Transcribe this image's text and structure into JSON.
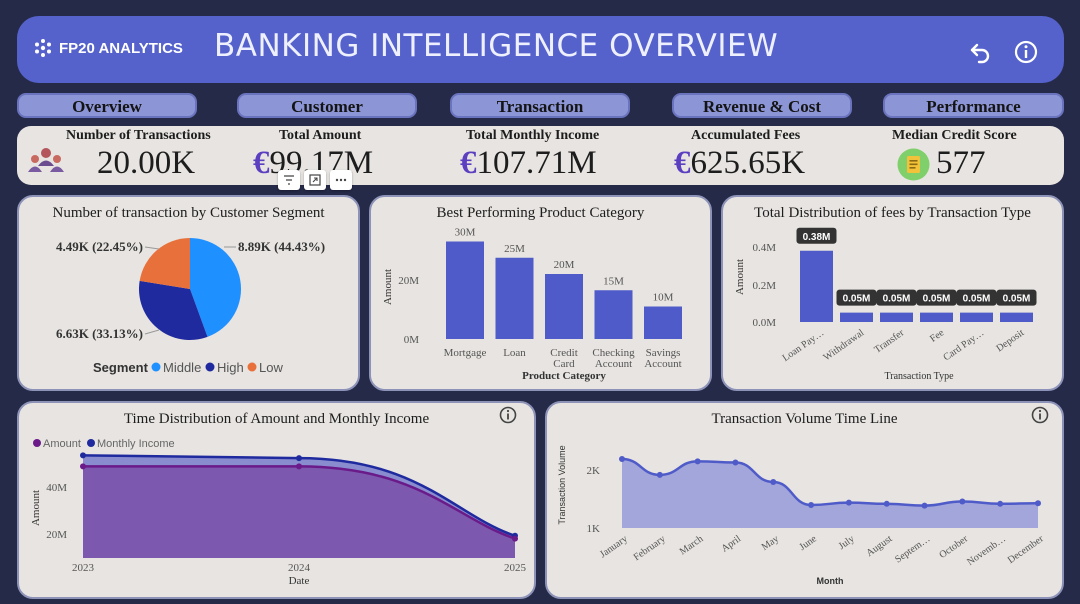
{
  "header": {
    "brand": "FP20 ANALYTICS",
    "title": "BANKING INTELLIGENCE OVERVIEW"
  },
  "tabs": [
    "Overview",
    "Customer",
    "Transaction",
    "Revenue & Cost",
    "Performance"
  ],
  "kpis": [
    {
      "label": "Number of Transactions",
      "value": "20.00K",
      "icon": "people-icon"
    },
    {
      "label": "Total Amount",
      "value": "99.17M",
      "currency": "€"
    },
    {
      "label": "Total Monthly Income",
      "value": "107.71M",
      "currency": "€"
    },
    {
      "label": "Accumulated Fees",
      "value": "625.65K",
      "currency": "€"
    },
    {
      "label": "Median Credit Score",
      "value": "577",
      "icon": "score-card-icon"
    }
  ],
  "colors": {
    "background": "#252a48",
    "header": "#5562cc",
    "bar": "#4f5bc8",
    "middle": "#1e90ff",
    "high": "#1f2a9e",
    "low": "#e8703a",
    "amount": "#6b1a8a",
    "income": "#1f2a9e"
  },
  "chart_data": [
    {
      "type": "pie",
      "title": "Number of transaction by Customer Segment",
      "legend_title": "Segment",
      "categories": [
        "Middle",
        "High",
        "Low"
      ],
      "values": [
        8.89,
        6.63,
        4.49
      ],
      "data_labels": [
        "8.89K (44.43%)",
        "6.63K (33.13%)",
        "4.49K (22.45%)"
      ],
      "legend_position": "bottom"
    },
    {
      "type": "bar",
      "title": "Best Performing Product Category",
      "xlabel": "Product Category",
      "ylabel": "Amount",
      "categories": [
        "Mortgage",
        "Loan",
        "Credit Card",
        "Checking Account",
        "Savings Account"
      ],
      "values": [
        30,
        25,
        20,
        15,
        10
      ],
      "data_labels": [
        "30M",
        "25M",
        "20M",
        "15M",
        "10M"
      ],
      "yticks": [
        "0M",
        "20M"
      ],
      "ylim": [
        0,
        32
      ]
    },
    {
      "type": "bar",
      "title": "Total Distribution of fees by Transaction Type",
      "xlabel": "Transaction Type",
      "ylabel": "Amount",
      "categories": [
        "Loan Pay…",
        "Withdrawal",
        "Transfer",
        "Fee",
        "Card Pay…",
        "Deposit"
      ],
      "values": [
        0.38,
        0.05,
        0.05,
        0.05,
        0.05,
        0.05
      ],
      "data_labels": [
        "0.38M",
        "0.05M",
        "0.05M",
        "0.05M",
        "0.05M",
        "0.05M"
      ],
      "yticks": [
        "0.0M",
        "0.2M",
        "0.4M"
      ],
      "ylim": [
        0,
        0.42
      ]
    },
    {
      "type": "area",
      "title": "Time Distribution of Amount and Monthly Income",
      "xlabel": "Date",
      "ylabel": "Amount",
      "x": [
        "2023",
        "2024",
        "2025"
      ],
      "series": [
        {
          "name": "Amount",
          "values": [
            43,
            43,
            17
          ]
        },
        {
          "name": "Monthly Income",
          "values": [
            47,
            46,
            18
          ]
        }
      ],
      "yticks": [
        "20M",
        "40M"
      ],
      "ylim": [
        10,
        50
      ],
      "legend_position": "top-left"
    },
    {
      "type": "area",
      "title": "Transaction Volume Time Line",
      "xlabel": "Month",
      "ylabel": "Transaction Volume",
      "x": [
        "January",
        "February",
        "March",
        "April",
        "May",
        "June",
        "July",
        "August",
        "Septem…",
        "October",
        "Novemb…",
        "December"
      ],
      "values": [
        2170,
        1900,
        2130,
        2110,
        1780,
        1390,
        1430,
        1410,
        1380,
        1450,
        1410,
        1420
      ],
      "yticks": [
        "1K",
        "2K"
      ],
      "ylim": [
        1000,
        2300
      ]
    }
  ]
}
